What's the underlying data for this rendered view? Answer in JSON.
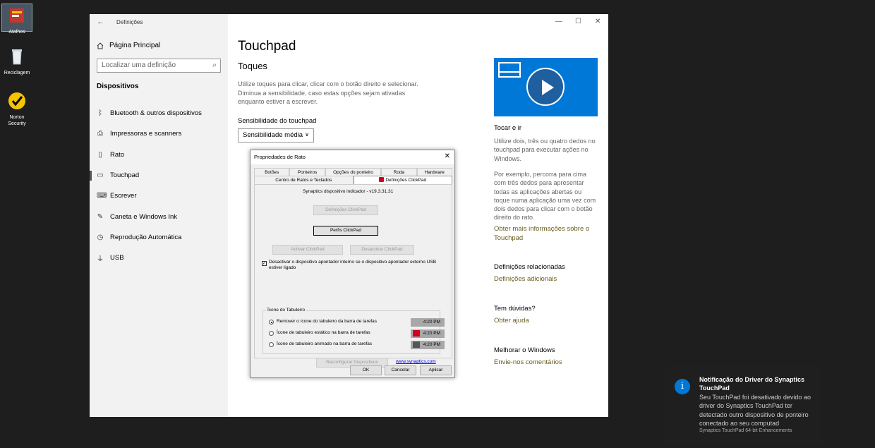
{
  "desktop": {
    "icons": [
      {
        "label": "Atalhos"
      },
      {
        "label": "Reciclagem"
      },
      {
        "label": "Norton Security"
      }
    ]
  },
  "settings": {
    "window_title": "Definições",
    "home": "Página Principal",
    "search_placeholder": "Localizar uma definição",
    "section": "Dispositivos",
    "nav": [
      {
        "label": "Bluetooth & outros dispositivos",
        "icon": "bluetooth-icon"
      },
      {
        "label": "Impressoras e scanners",
        "icon": "printer-icon"
      },
      {
        "label": "Rato",
        "icon": "mouse-icon"
      },
      {
        "label": "Touchpad",
        "icon": "touchpad-icon"
      },
      {
        "label": "Escrever",
        "icon": "keyboard-icon"
      },
      {
        "label": "Caneta e Windows Ink",
        "icon": "pen-icon"
      },
      {
        "label": "Reprodução Automática",
        "icon": "autoplay-icon"
      },
      {
        "label": "USB",
        "icon": "usb-icon"
      }
    ],
    "active_nav": "Touchpad",
    "page_title": "Touchpad",
    "sub_title": "Toques",
    "description": "Utilize toques para clicar, clicar com o botão direito e selecionar. Diminua a sensibilidade, caso estas opções sejam ativadas enquanto estiver a escrever.",
    "sensitivity_label": "Sensibilidade do touchpad",
    "sensitivity_value": "Sensibilidade média",
    "right": {
      "video_title": "Tocar e ir",
      "p1": "Utilize dois, três ou quatro dedos no touchpad para executar ações no Windows.",
      "p2": "Por exemplo, percorra para cima com três dedos para apresentar todas as aplicações abertas ou toque numa aplicação uma vez com dois dedos para clicar com o botão direito do rato.",
      "more_link": "Obter mais informações sobre o Touchpad",
      "related_title": "Definições relacionadas",
      "related_link": "Definições adicionais",
      "questions_title": "Tem dúvidas?",
      "help_link": "Obter ajuda",
      "improve_title": "Melhorar o Windows",
      "feedback_link": "Envie-nos comentários"
    }
  },
  "dialog": {
    "title": "Propriedades de Rato",
    "tabs_row1": [
      "Botões",
      "Ponteiros",
      "Opções do ponteiro",
      "Roda",
      "Hardware"
    ],
    "tabs_row2": [
      "Centro de Ratos e Teclados",
      "Definições ClickPad"
    ],
    "driver_text": "Synaptics dispositivo indicador - v19.3.31.31",
    "btn_clickpad_settings": "Definições ClickPad",
    "btn_clickpad_profiles": "Perfis ClickPad",
    "btn_activate": "Activar ClickPad",
    "btn_deactivate": "Desactivar ClickPad",
    "checkbox_text": "Desactivar o dispositivo apontador interno se o dispositivo apontador externo USB estiver ligado",
    "checkbox_checked": true,
    "group_title": "Ícone do Tabuleiro",
    "radios": [
      {
        "label": "Remover o ícone do tabuleiro da barra de tarefas",
        "time": "4:20 PM",
        "checked": true
      },
      {
        "label": "Ícone de tabuleiro estático na barra de tarefas",
        "time": "4:20 PM",
        "checked": false
      },
      {
        "label": "Ícone de tabuleiro animado na barra de tarefas",
        "time": "4:20 PM",
        "checked": false
      }
    ],
    "btn_reconfigure": "Reconfigurar Dispositivos",
    "website_link": "www.synaptics.com",
    "btn_ok": "OK",
    "btn_cancel": "Cancelar",
    "btn_apply": "Aplicar"
  },
  "toast": {
    "title": "Notificação do Driver do Synaptics TouchPad",
    "body": "Seu TouchPad foi desativado devido ao driver do Synaptics TouchPad ter detectado outro dispositivo de ponteiro conectado ao seu computad",
    "source": "Synaptics TouchPad 64-bit Enhancements"
  },
  "colors": {
    "accent": "#0078d7",
    "link": "#6a5d1e",
    "toast_bg": "#1f1f1f",
    "sidebar_bg": "#f2f2f2"
  }
}
